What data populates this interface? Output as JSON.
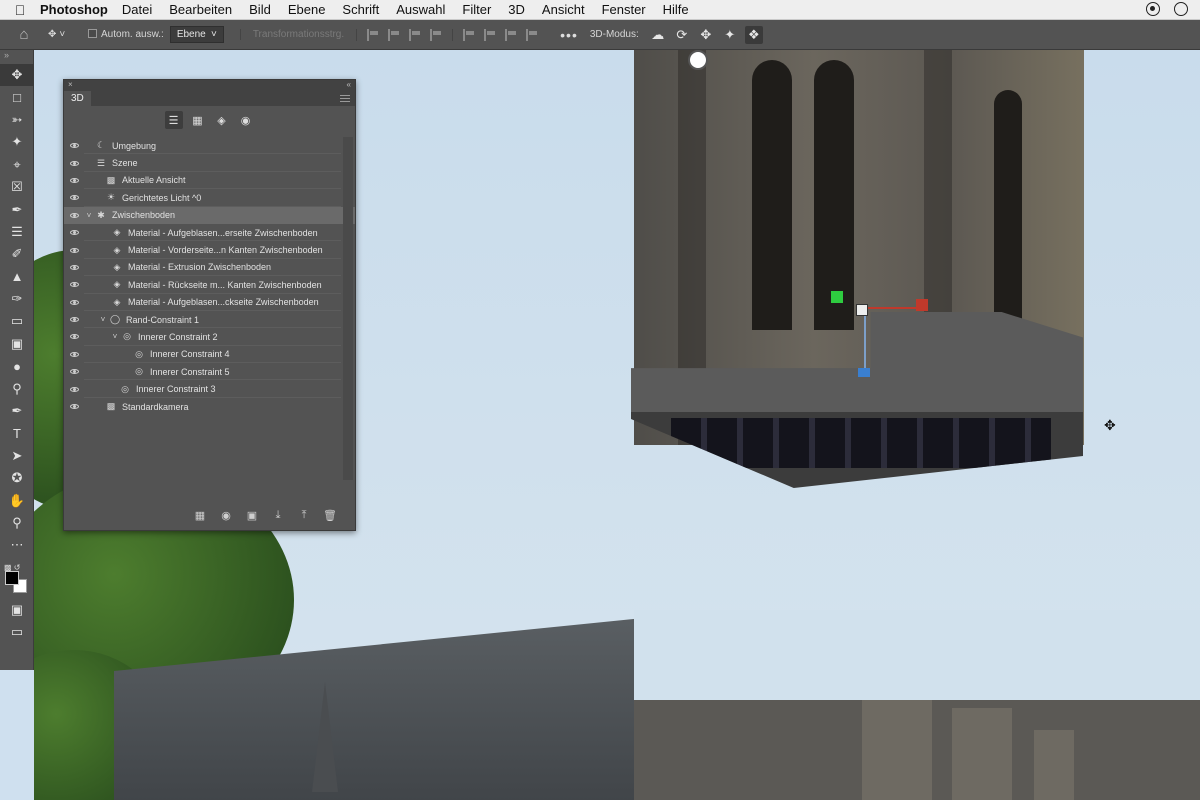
{
  "menubar": {
    "app_name": "Photoshop",
    "items": [
      "Datei",
      "Bearbeiten",
      "Bild",
      "Ebene",
      "Schrift",
      "Auswahl",
      "Filter",
      "3D",
      "Ansicht",
      "Fenster",
      "Hilfe"
    ]
  },
  "options_bar": {
    "auto_select_label": "Autom. ausw.:",
    "auto_select_value": "Ebene",
    "transform_controls_label": "Transformationsstrg.",
    "mode_label": "3D-Modus:",
    "more_label": "•••"
  },
  "panel_3d": {
    "tab_label": "3D",
    "items": [
      {
        "label": "Umgebung",
        "icon": "environment-icon"
      },
      {
        "label": "Szene",
        "icon": "scene-icon"
      },
      {
        "label": "Aktuelle Ansicht",
        "icon": "camera-icon"
      },
      {
        "label": "Gerichtetes Licht ^0",
        "icon": "light-icon"
      },
      {
        "label": "Zwischenboden",
        "icon": "mesh-icon"
      },
      {
        "label": "Material - Aufgeblasen...erseite Zwischenboden",
        "icon": "material-icon"
      },
      {
        "label": "Material - Vorderseite...n Kanten Zwischenboden",
        "icon": "material-icon"
      },
      {
        "label": "Material - Extrusion Zwischenboden",
        "icon": "material-icon"
      },
      {
        "label": "Material - Rückseite m... Kanten Zwischenboden",
        "icon": "material-icon"
      },
      {
        "label": "Material - Aufgeblasen...ckseite Zwischenboden",
        "icon": "material-icon"
      },
      {
        "label": "Rand-Constraint 1",
        "icon": "constraint-icon"
      },
      {
        "label": "Innerer Constraint 2",
        "icon": "constraint-icon"
      },
      {
        "label": "Innerer Constraint 4",
        "icon": "constraint-icon"
      },
      {
        "label": "Innerer Constraint 5",
        "icon": "constraint-icon"
      },
      {
        "label": "Innerer Constraint 3",
        "icon": "constraint-icon"
      },
      {
        "label": "Standardkamera",
        "icon": "camera-icon"
      }
    ],
    "selected_item": "Zwischenboden"
  },
  "colors": {
    "ui_dark": "#535353",
    "ui_darker": "#3a3a3a",
    "sky": "#cfe0ef",
    "gizmo_red": "#c0392b",
    "gizmo_green": "#2ecc40",
    "gizmo_blue": "#3a7fd0"
  }
}
